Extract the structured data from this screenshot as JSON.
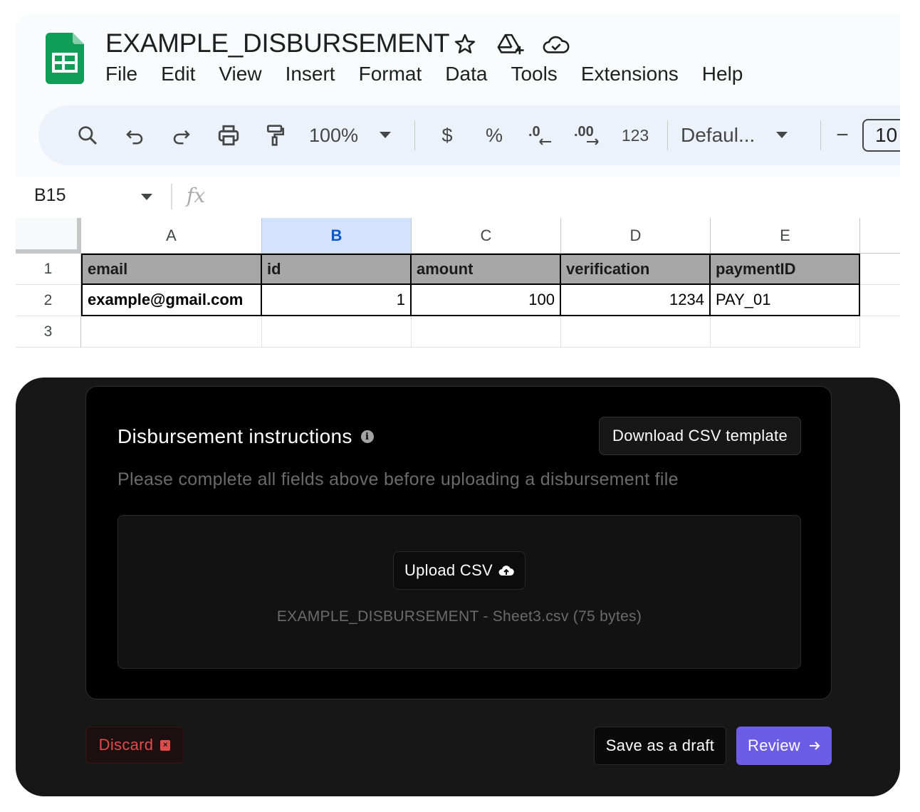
{
  "sheets": {
    "title": "EXAMPLE_DISBURSEMENT",
    "title_icons": [
      "star-icon",
      "move-to-drive-icon",
      "cloud-saved-icon"
    ],
    "menu": [
      "File",
      "Edit",
      "View",
      "Insert",
      "Format",
      "Data",
      "Tools",
      "Extensions",
      "Help"
    ],
    "toolbar": {
      "icons": [
        "search-icon",
        "undo-icon",
        "redo-icon",
        "print-icon",
        "paint-format-icon"
      ],
      "zoom": "100%",
      "currency": "$",
      "percent": "%",
      "decrease_decimal": ".0",
      "increase_decimal": ".00",
      "number_format": "123",
      "font": "Defaul...",
      "font_size_decrease": "−",
      "font_size": "10"
    },
    "formula_bar": {
      "name_box": "B15",
      "fx": "fx",
      "value": ""
    },
    "grid": {
      "columns": [
        "A",
        "B",
        "C",
        "D",
        "E"
      ],
      "selected_column": "B",
      "rows": [
        "1",
        "2",
        "3"
      ],
      "header_row": [
        "email",
        "id",
        "amount",
        "verification",
        "paymentID"
      ],
      "data_row": [
        "example@gmail.com",
        "1",
        "100",
        "1234",
        "PAY_01"
      ]
    }
  },
  "disbursement": {
    "title": "Disbursement instructions",
    "info_icon": "info-icon",
    "download_label": "Download CSV template",
    "note": "Please complete all fields above before uploading a disbursement file",
    "upload_label": "Upload CSV",
    "upload_icon": "cloud-upload-icon",
    "file_info": "EXAMPLE_DISBURSEMENT - Sheet3.csv (75 bytes)",
    "discard_label": "Discard",
    "draft_label": "Save as a draft",
    "review_label": "Review",
    "review_icon": "arrow-right-icon"
  },
  "colors": {
    "sheets_green": "#0f9d58",
    "selected_col": "#d3e3fd",
    "header_fill": "#a7a7a7",
    "dark_bg": "#171717",
    "review_purple": "#6d5ce6",
    "discard_red": "#e34b4b"
  }
}
